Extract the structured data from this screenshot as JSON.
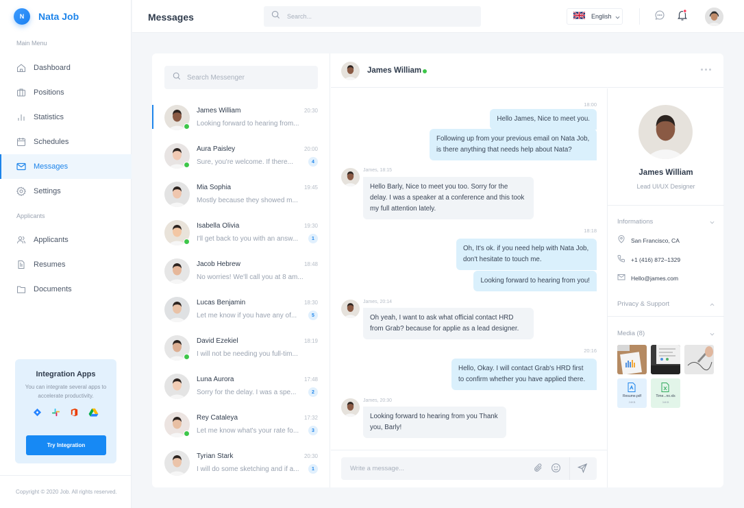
{
  "brand": {
    "logo_letter": "N",
    "name": "Nata Job"
  },
  "sidebar": {
    "main_menu_label": "Main Menu",
    "main_items": [
      {
        "label": "Dashboard",
        "icon": "home-icon"
      },
      {
        "label": "Positions",
        "icon": "briefcase-icon"
      },
      {
        "label": "Statistics",
        "icon": "bar-chart-icon"
      },
      {
        "label": "Schedules",
        "icon": "calendar-icon"
      },
      {
        "label": "Messages",
        "icon": "mail-icon",
        "active": true
      },
      {
        "label": "Settings",
        "icon": "gear-icon"
      }
    ],
    "applicants_label": "Applicants",
    "applicant_items": [
      {
        "label": "Applicants",
        "icon": "users-icon"
      },
      {
        "label": "Resumes",
        "icon": "document-icon"
      },
      {
        "label": "Documents",
        "icon": "folder-icon"
      }
    ],
    "integration": {
      "title": "Integration Apps",
      "description": "You can integrate several apps to accelerate productivity.",
      "apps": [
        "jira-icon",
        "slack-icon",
        "office-icon",
        "google-drive-icon"
      ],
      "button_label": "Try Integration"
    },
    "copyright": "Copyright © 2020 Job. All rights reserved."
  },
  "topbar": {
    "title": "Messages",
    "search_placeholder": "Search...",
    "language": "English",
    "notification_dot_color": "#ff3b5c"
  },
  "conversations": {
    "search_placeholder": "Search Messenger",
    "items": [
      {
        "name": "James William",
        "preview": "Looking forward to hearing from...",
        "time": "20:30",
        "online": true,
        "unread": null,
        "active": true,
        "skin": "#8a5a44",
        "bg": "#e6e2dc"
      },
      {
        "name": "Aura Paisley",
        "preview": "Sure, you're welcome. If there...",
        "time": "20:00",
        "online": true,
        "unread": "4",
        "skin": "#f1c9b3",
        "bg": "#e8e4e3"
      },
      {
        "name": "Mia Sophia",
        "preview": "Mostly because they showed m...",
        "time": "19:45",
        "online": false,
        "unread": null,
        "skin": "#efc6ae",
        "bg": "#e3e3e3"
      },
      {
        "name": "Isabella Olivia",
        "preview": "I'll get back to you with an answ...",
        "time": "19:30",
        "online": true,
        "unread": "1",
        "skin": "#f3c7a4",
        "bg": "#e9e3da"
      },
      {
        "name": "Jacob Hebrew",
        "preview": "No worries! We'll call you at 8 am...",
        "time": "18:48",
        "online": false,
        "unread": null,
        "skin": "#e6b79a",
        "bg": "#e6e6e6"
      },
      {
        "name": "Lucas Benjamin",
        "preview": "Let me know if you have any of...",
        "time": "18:30",
        "online": false,
        "unread": "5",
        "skin": "#e9c2a7",
        "bg": "#dfe1e3"
      },
      {
        "name": "David Ezekiel",
        "preview": "I will not be needing you full-tim...",
        "time": "18:19",
        "online": true,
        "unread": null,
        "skin": "#dcae92",
        "bg": "#e6e6e6"
      },
      {
        "name": "Luna Aurora",
        "preview": "Sorry for the delay. I was a spe...",
        "time": "17:48",
        "online": false,
        "unread": "2",
        "skin": "#f2cdb5",
        "bg": "#e4e4e4"
      },
      {
        "name": "Rey Cataleya",
        "preview": "Let me know what's your rate fo...",
        "time": "17:32",
        "online": true,
        "unread": "3",
        "skin": "#e8bfa3",
        "bg": "#ece4e1"
      },
      {
        "name": "Tyrian Stark",
        "preview": "I will do some sketching and if a...",
        "time": "20:30",
        "online": false,
        "unread": "1",
        "skin": "#ebc4aa",
        "bg": "#e6e6e6"
      }
    ]
  },
  "chat": {
    "contact_name": "James William",
    "online": true,
    "messages": [
      {
        "type": "time",
        "text": "18:00"
      },
      {
        "type": "out",
        "text": "Hello James, Nice to meet you."
      },
      {
        "type": "out",
        "text": "Following up from your previous email on Nata Job, is there anything that needs help about Nata?"
      },
      {
        "type": "in",
        "meta": "James, 18:15",
        "text": "Hello Barly, Nice to meet you too. Sorry for the delay. I was a speaker at a conference and this took my full attention lately."
      },
      {
        "type": "time",
        "text": "18:18"
      },
      {
        "type": "out",
        "text": "Oh, It's ok. if you need help with Nata Job, don't hesitate to touch me."
      },
      {
        "type": "out",
        "text": "Looking forward to hearing from you!"
      },
      {
        "type": "in",
        "meta": "James, 20:14",
        "text": "Oh yeah, I want to ask what official contact HRD from Grab? because for applie as a lead designer."
      },
      {
        "type": "time",
        "text": "20:16"
      },
      {
        "type": "out",
        "text": "Hello, Okay. I will contact Grab's HRD first to confirm whether you have applied there."
      },
      {
        "type": "in",
        "meta": "James, 20:30",
        "text": "Looking forward to hearing from you Thank you, Barly!"
      }
    ],
    "composer_placeholder": "Write a message..."
  },
  "profile": {
    "name": "James William",
    "role": "Lead UI/UX Designer",
    "informations_label": "Informations",
    "location": "San Francisco, CA",
    "phone": "+1 (416) 872–1329",
    "email": "Hello@james.com",
    "privacy_label": "Privacy & Support",
    "media_label": "Media (8)",
    "files": [
      {
        "name": "Resume.pdf",
        "size": "24KB",
        "kind": "pdf"
      },
      {
        "name": "Time...no.xls",
        "size": "34KB",
        "kind": "xls"
      }
    ]
  },
  "colors": {
    "accent": "#1d84ea",
    "online": "#3ec64a",
    "outgoing_bubble": "#daf0fc",
    "incoming_bubble": "#f1f4f7"
  }
}
